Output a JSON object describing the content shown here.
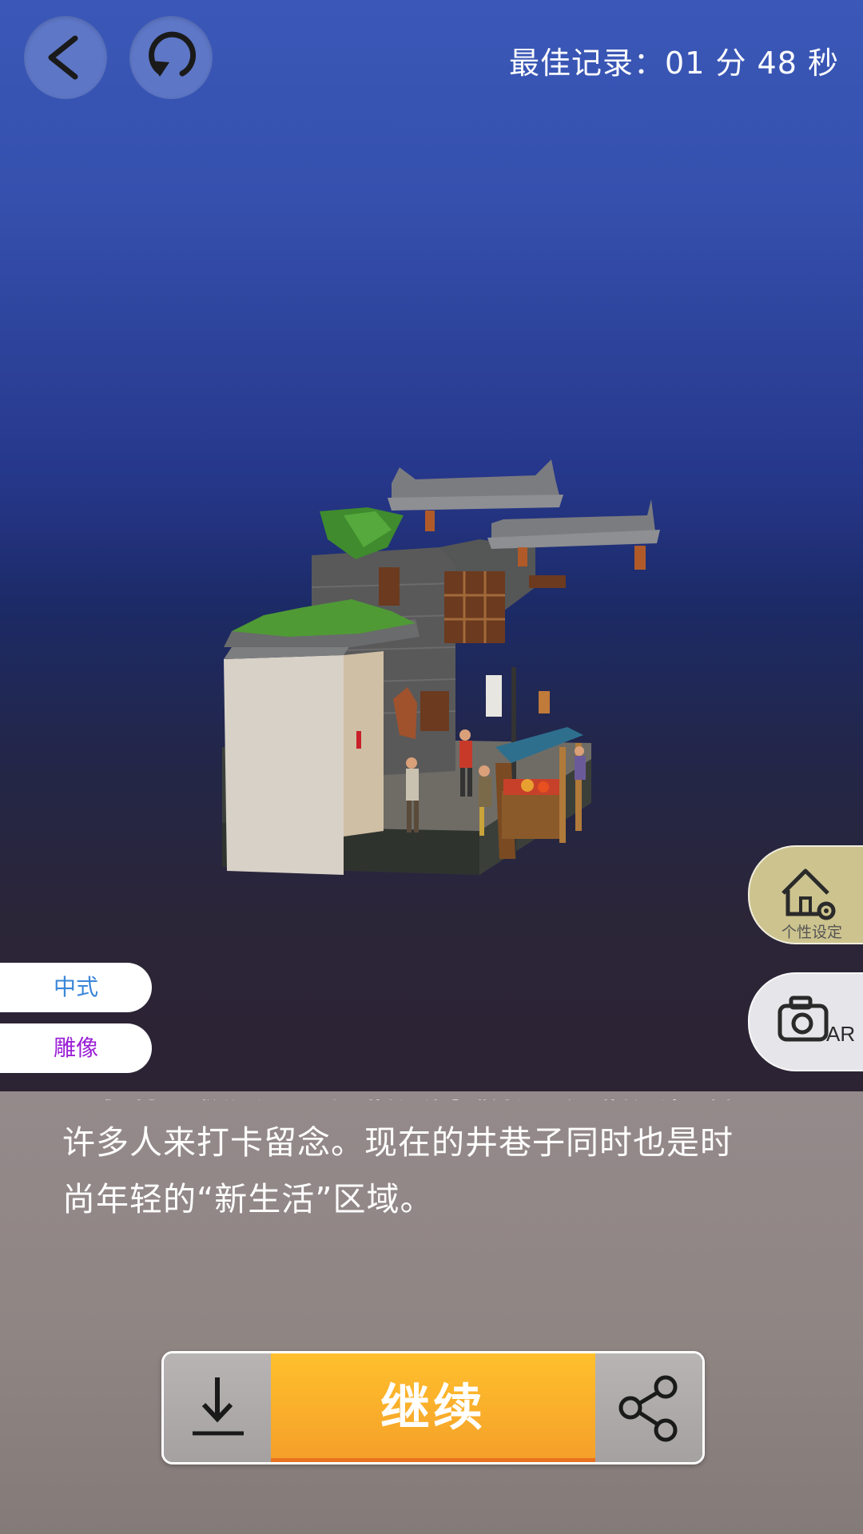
{
  "header": {
    "back_icon": "chevron-left-icon",
    "restart_icon": "refresh-icon",
    "best_record": "最佳记录：01 分 48 秒"
  },
  "side_buttons": {
    "settings_label": "个性设定",
    "settings_icon": "house-gear-icon",
    "ar_label": "AR",
    "ar_icon": "camera-icon"
  },
  "tags": {
    "style": "中式",
    "type": "雕像"
  },
  "description": {
    "lines": [
      "巷子有一极其重的民俗风韵缩影的民俗文化墙。",
      "许多人来打卡留念。现在的井巷子同时也是时",
      "尚年轻的“新生活”区域。"
    ]
  },
  "actions": {
    "download_icon": "download-icon",
    "continue_label": "继续",
    "share_icon": "share-icon"
  },
  "colors": {
    "accent_orange": "#f5a02a",
    "tag_style_color": "#3a86d8",
    "tag_type_color": "#9b1fd6",
    "settings_bg": "#cdc38e"
  }
}
